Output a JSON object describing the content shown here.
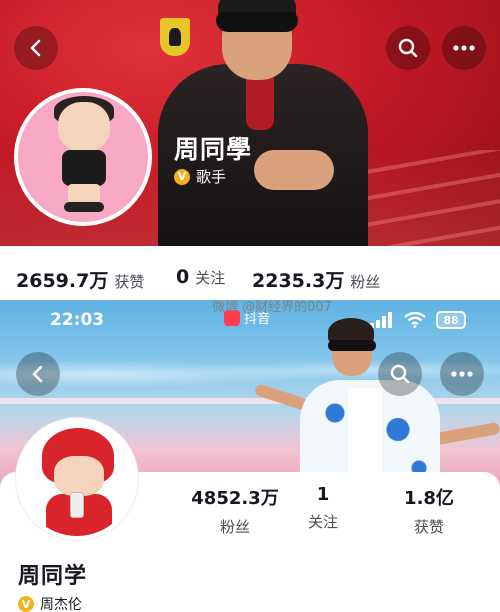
{
  "top_profile": {
    "name": "周同學",
    "verification": "歌手",
    "stats": [
      {
        "value": "2659.7万",
        "label": "获赞"
      },
      {
        "value": "0",
        "label": "关注"
      },
      {
        "value": "2235.3万",
        "label": "粉丝"
      }
    ]
  },
  "watermark": "微博 @财经界的007",
  "status_bar": {
    "time": "22:03",
    "app_label": "抖音",
    "battery": "88"
  },
  "bottom_profile": {
    "name": "周同学",
    "verification": "周杰伦",
    "stats": [
      {
        "value": "4852.3万",
        "label": "粉丝"
      },
      {
        "value": "1",
        "label": "关注"
      },
      {
        "value": "1.8亿",
        "label": "获赞"
      }
    ]
  },
  "colors": {
    "top_cover": "#c41a25",
    "verify_badge": "#f2b21d",
    "text_primary": "#161823",
    "text_secondary": "#4b4c55"
  },
  "icons": [
    "back-icon",
    "search-icon",
    "more-icon",
    "verified-badge-icon",
    "signal-icon",
    "wifi-icon",
    "battery-icon"
  ]
}
